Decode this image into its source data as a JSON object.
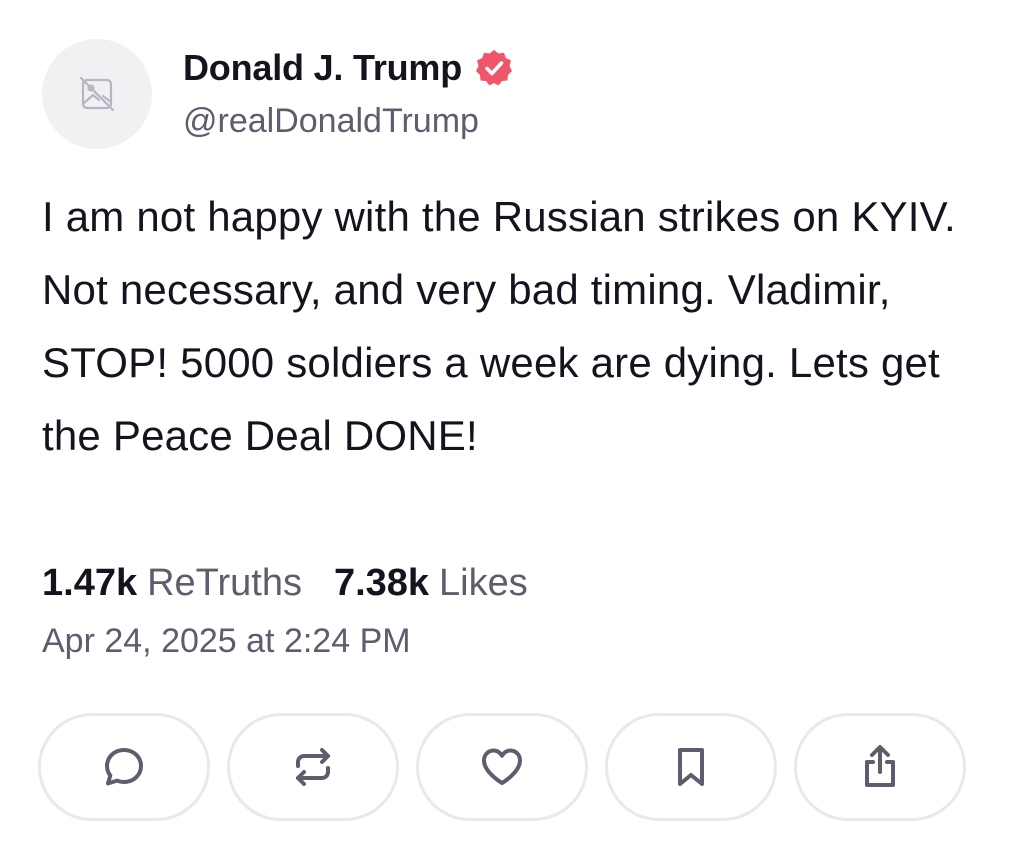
{
  "author": {
    "display_name": "Donald J. Trump",
    "handle": "@realDonaldTrump",
    "verified": true,
    "verified_color": "#f0566a",
    "avatar_icon": "broken-image-icon"
  },
  "post": {
    "text": "I am not happy with the Russian strikes on KYIV. Not necessary, and very bad timing. Vladimir, STOP! 5000 soldiers a week are dying. Lets get the Peace Deal DONE!"
  },
  "stats": {
    "retruths_count": "1.47k",
    "retruths_label": "ReTruths",
    "likes_count": "7.38k",
    "likes_label": "Likes"
  },
  "timestamp": "Apr 24, 2025 at 2:24 PM",
  "actions": [
    {
      "name": "reply",
      "icon": "comment-icon"
    },
    {
      "name": "retruth",
      "icon": "repost-icon"
    },
    {
      "name": "like",
      "icon": "heart-icon"
    },
    {
      "name": "bookmark",
      "icon": "bookmark-icon"
    },
    {
      "name": "share",
      "icon": "share-icon"
    }
  ],
  "colors": {
    "text_primary": "#14141f",
    "text_secondary": "#5d5d6e",
    "icon": "#5d5d6e",
    "button_border": "#e8e8ee"
  }
}
